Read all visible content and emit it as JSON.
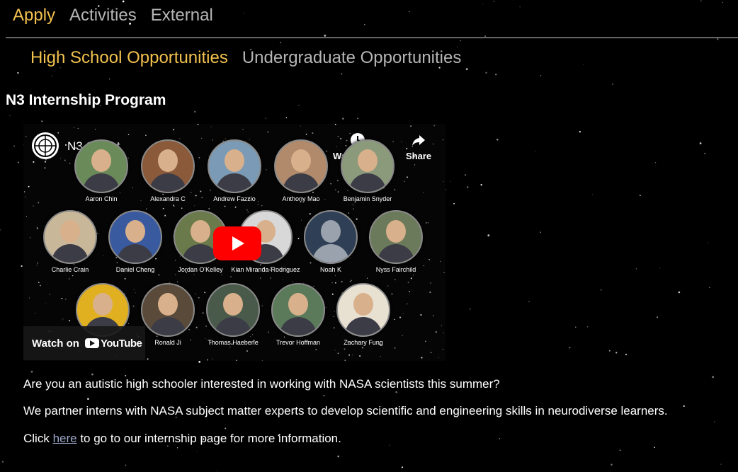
{
  "nav": {
    "tabs": [
      {
        "label": "Apply",
        "active": true
      },
      {
        "label": "Activities",
        "active": false
      },
      {
        "label": "External",
        "active": false
      }
    ],
    "active_color": "#f2c14e",
    "idle_color": "#b5b5b5"
  },
  "subnav": {
    "tabs": [
      {
        "label": "High School Opportunities",
        "active": true
      },
      {
        "label": "Undergraduate Opportunities",
        "active": false
      }
    ]
  },
  "section": {
    "title": "N3 Internship Program"
  },
  "video": {
    "channel_name": "N3 SciAct",
    "watch_later_label": "Watch later",
    "share_label": "Share",
    "watch_on_label": "Watch on",
    "youtube_word": "YouTube",
    "play_color": "#ff0000",
    "people": [
      {
        "name": "Aaron Chin",
        "color": "#6a8a5a"
      },
      {
        "name": "Alexandra C",
        "color": "#8b5a3a"
      },
      {
        "name": "Andrew Fazzio",
        "color": "#7a9ab5"
      },
      {
        "name": "Anthony Mao",
        "color": "#b08a6a"
      },
      {
        "name": "Benjamin Snyder",
        "color": "#8a9a7a"
      },
      {
        "name": "Charlie Crain",
        "color": "#c9b79a"
      },
      {
        "name": "Daniel Cheng",
        "color": "#3a5aa0"
      },
      {
        "name": "Jordan O'Kelley",
        "color": "#6a7a4a"
      },
      {
        "name": "Kian Miranda-Rodriguez",
        "color": "#d8d8d8"
      },
      {
        "name": "Noah K",
        "color": "#2f3f56"
      },
      {
        "name": "Nyss Fairchild",
        "color": "#6a7a5a"
      },
      {
        "name": "",
        "color": "#e0b020"
      },
      {
        "name": "Ronald Ji",
        "color": "#5a4a3a"
      },
      {
        "name": "Thomas Haeberle",
        "color": "#4a5a4a"
      },
      {
        "name": "Trevor Hoffman",
        "color": "#5a7a5a"
      },
      {
        "name": "Zachary Fung",
        "color": "#e8e0d0"
      }
    ]
  },
  "body": {
    "p1": "Are you an autistic high schooler interested in working with NASA scientists this summer?",
    "p2": "We partner interns with NASA subject matter experts to develop scientific and engineering skills in neurodiverse learners.",
    "p3_before": "Click ",
    "p3_link": "here",
    "p3_after": " to go to our internship page for more information."
  }
}
